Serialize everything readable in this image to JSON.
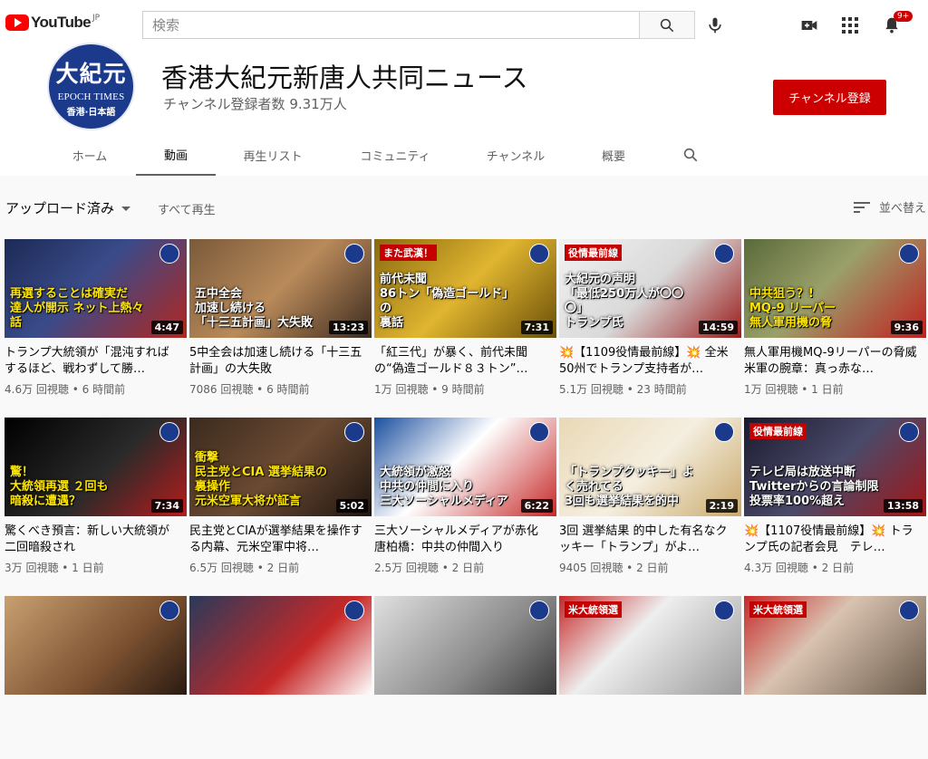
{
  "masthead": {
    "logo_text": "YouTube",
    "logo_country": "JP",
    "search_placeholder": "検索",
    "notification_count": "9+"
  },
  "channel": {
    "avatar_line1": "大紀元",
    "avatar_line2": "EPOCH TIMES",
    "avatar_line3": "香港·日本語",
    "title": "香港大紀元新唐人共同ニュース",
    "subscribers": "チャンネル登録者数 9.31万人",
    "subscribe_label": "チャンネル登録",
    "tabs": [
      "ホーム",
      "動画",
      "再生リスト",
      "コミュニティ",
      "チャンネル",
      "概要"
    ],
    "active_tab": 1
  },
  "toolbar": {
    "sort_label": "アップロード済み",
    "play_all": "すべて再生",
    "sort_by": "並べ替え"
  },
  "colors": {
    "brand_red": "#ff0000",
    "subscribe_red": "#cc0000",
    "channel_blue": "#1b3a8c"
  },
  "videos": [
    {
      "title": "トランプ大統領が「混沌すればするほど、戦わずして勝…",
      "views": "4.6万 回視聴",
      "age": "6 時間前",
      "duration": "4:47",
      "caption": "再選することは確実だ\n達人が開示 ネット上熱々話",
      "tag": "",
      "bg": "linear-gradient(135deg,#1d2a55 0%,#3a4b8a 45%,#b3261e 100%)",
      "caption_color": "yellow"
    },
    {
      "title": "5中全会は加速し続ける「十三五計画」の大失敗",
      "views": "7086 回視聴",
      "age": "6 時間前",
      "duration": "13:23",
      "caption": "五中全会\n加速し続ける\n「十三五計画」大失敗",
      "tag": "",
      "bg": "linear-gradient(135deg,#7a5a3a 0%,#b98a5a 50%,#3c2b1f 100%)",
      "caption_color": "white"
    },
    {
      "title": "「紅三代」が暴く、前代未聞の“偽造ゴールド８３トン”…",
      "views": "1万 回視聴",
      "age": "9 時間前",
      "duration": "7:31",
      "caption": "前代未聞\n86トン「偽造ゴールド」の\n裏話",
      "tag": "また武漢！",
      "bg": "linear-gradient(135deg,#8a6a10 0%,#e0b530 50%,#6b4f08 100%)",
      "caption_color": "white"
    },
    {
      "title": "💥【1109役情最前線】💥 全米50州でトランプ支持者が…",
      "views": "5.1万 回視聴",
      "age": "23 時間前",
      "duration": "14:59",
      "caption": "大紀元の声明\n「最低250万人が〇〇〇」\nトランプ氏",
      "tag": "役情最前線",
      "bg": "linear-gradient(135deg,#f2f2f2 0%,#d9d9d9 50%,#9b1b1b 100%)",
      "caption_color": "white"
    },
    {
      "title": "無人軍用機MQ-9リーパーの脅威米軍の腕章：真っ赤な…",
      "views": "1万 回視聴",
      "age": "1 日前",
      "duration": "9:36",
      "caption": "中共狙う？!\nMQ-9 リーパー\n無人軍用機の脅",
      "tag": "",
      "bg": "linear-gradient(135deg,#5a6a3a 0%,#9aa06a 45%,#c02020 100%)",
      "caption_color": "yellow"
    },
    {
      "title": "驚くべき預言：新しい大統領が二回暗殺され",
      "views": "3万 回視聴",
      "age": "1 日前",
      "duration": "7:34",
      "caption": "驚！\n大統領再選 ２回も\n暗殺に遭遇？",
      "tag": "",
      "bg": "linear-gradient(135deg,#000 0%,#2a2a2a 55%,#b71c1c 100%)",
      "caption_color": "yellow"
    },
    {
      "title": "民主党とCIAが選挙結果を操作する内幕、元米空軍中将…",
      "views": "6.5万 回視聴",
      "age": "2 日前",
      "duration": "5:02",
      "caption": "衝撃\n民主党とCIA 選挙結果の裏操作\n元米空軍大将が証言",
      "tag": "",
      "bg": "linear-gradient(135deg,#3b2a1e 0%,#6b4a32 50%,#1e1510 100%)",
      "caption_color": "yellow"
    },
    {
      "title": "三大ソーシャルメディアが赤化　唐柏橋：中共の仲間入り",
      "views": "2.5万 回視聴",
      "age": "2 日前",
      "duration": "6:22",
      "caption": "大統領が激怒\n中共の仲間に入り\n三大ソーシャルメディア",
      "tag": "",
      "bg": "linear-gradient(135deg,#1c4fa0 0%,#ffffff 45%,#c62828 100%)",
      "caption_color": "white"
    },
    {
      "title": "3回 選挙結果 的中した有名なクッキー「トランプ」がよ…",
      "views": "9405 回視聴",
      "age": "2 日前",
      "duration": "2:19",
      "caption": "「トランプクッキー」よく売れてる\n3回も選挙結果を的中",
      "tag": "",
      "bg": "linear-gradient(135deg,#e9d8b5 0%,#f5efe0 50%,#c9a86a 100%)",
      "caption_color": "white"
    },
    {
      "title": "💥【1107役情最前線】💥 トランプ氏の記者会見　テレ…",
      "views": "4.3万 回視聴",
      "age": "2 日前",
      "duration": "13:58",
      "caption": "テレビ局は放送中断\nTwitterからの言論制限\n投票率100%超え",
      "tag": "役情最前線",
      "bg": "linear-gradient(135deg,#1a1a2e 0%,#4a4a6a 50%,#a31515 100%)",
      "caption_color": "white"
    },
    {
      "title": "",
      "views": "",
      "age": "",
      "duration": "",
      "caption": "",
      "tag": "",
      "bg": "linear-gradient(135deg,#c9a070 0%,#7a5030 60%,#2a1a10 100%)",
      "caption_color": "white"
    },
    {
      "title": "",
      "views": "",
      "age": "",
      "duration": "",
      "caption": "",
      "tag": "",
      "bg": "linear-gradient(135deg,#2a3a5a 0%,#c62828 60%,#ffffff 100%)",
      "caption_color": "white"
    },
    {
      "title": "",
      "views": "",
      "age": "",
      "duration": "",
      "caption": "",
      "tag": "",
      "bg": "linear-gradient(135deg,#e0e0e0 0%,#8a8a8a 60%,#3a3a3a 100%)",
      "caption_color": "white"
    },
    {
      "title": "",
      "views": "",
      "age": "",
      "duration": "",
      "caption": "",
      "tag": "米大統領選",
      "bg": "linear-gradient(135deg,#c62828 0%,#eeeeee 40%,#9a9a9a 100%)",
      "caption_color": "white"
    },
    {
      "title": "",
      "views": "",
      "age": "",
      "duration": "",
      "caption": "",
      "tag": "米大統領選",
      "bg": "linear-gradient(135deg,#c62828 0%,#d9c2b0 40%,#6a5a4a 100%)",
      "caption_color": "white"
    }
  ]
}
